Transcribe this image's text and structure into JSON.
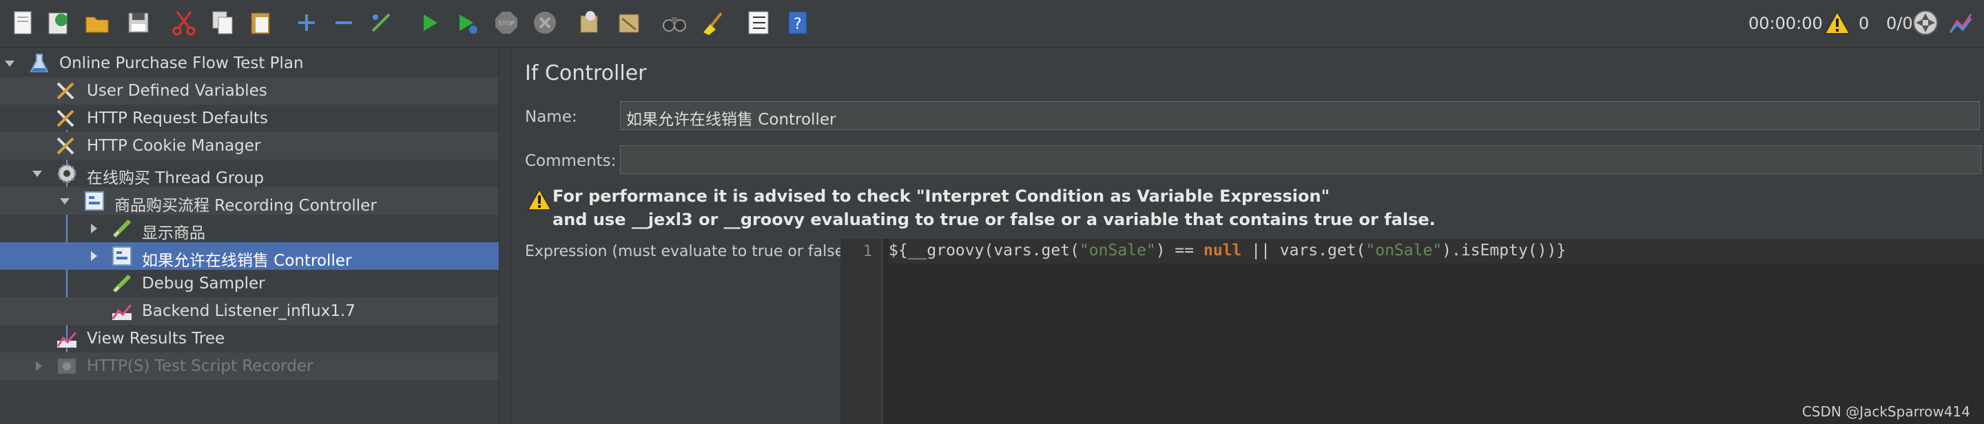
{
  "toolbar": {
    "timer": "00:00:00",
    "warning_count": "0",
    "thread_ratio": "0/0",
    "icons": [
      "new-icon",
      "templates-icon",
      "open-icon",
      "save-icon",
      "cut-icon",
      "copy-icon",
      "paste-icon",
      "expand-icon",
      "collapse-icon",
      "toggle-icon",
      "start-icon",
      "start-no-pauses-icon",
      "stop-icon",
      "shutdown-icon",
      "clear-icon",
      "clear-all-icon",
      "search-icon",
      "reset-search-icon",
      "function-helper-icon",
      "help-icon"
    ]
  },
  "tree": {
    "nodes": [
      {
        "label": "Online Purchase Flow Test Plan",
        "icon": "flask-icon"
      },
      {
        "label": "User Defined Variables",
        "icon": "wrench-icon"
      },
      {
        "label": "HTTP Request Defaults",
        "icon": "wrench-icon"
      },
      {
        "label": "HTTP Cookie Manager",
        "icon": "wrench-icon"
      },
      {
        "label": "在线购买 Thread Group",
        "icon": "gear-icon"
      },
      {
        "label": "商品购买流程 Recording Controller",
        "icon": "controller-icon"
      },
      {
        "label": "显示商品",
        "icon": "sampler-icon"
      },
      {
        "label": "如果允许在线销售 Controller",
        "icon": "controller-icon"
      },
      {
        "label": "Debug Sampler",
        "icon": "sampler-icon"
      },
      {
        "label": "Backend Listener_influx1.7",
        "icon": "listener-icon"
      },
      {
        "label": "View Results Tree",
        "icon": "listener-icon"
      },
      {
        "label": "HTTP(S) Test Script Recorder",
        "icon": "recorder-icon"
      }
    ]
  },
  "panel": {
    "title": "If Controller",
    "name_label": "Name:",
    "name_value": "如果允许在线销售 Controller",
    "comments_label": "Comments:",
    "comments_value": "",
    "warning_line1": "For performance it is advised to check \"Interpret Condition as Variable Expression\"",
    "warning_line2": "and use __jexl3 or __groovy evaluating to true or false or a variable that contains true or false.",
    "expression_label": "Expression (must evaluate to true or false)",
    "line_number": "1",
    "code": {
      "p1": "${__groovy(vars.get(",
      "s1": "\"onSale\"",
      "p2": ") == ",
      "k1": "null",
      "p3": " || vars.get(",
      "s2": "\"onSale\"",
      "p4": ").isEmpty())}"
    }
  },
  "watermark": "CSDN @JackSparrow414",
  "colors": {
    "selection": "#4b6eaf",
    "background": "#3c3f41",
    "editor": "#2b2b2b"
  }
}
